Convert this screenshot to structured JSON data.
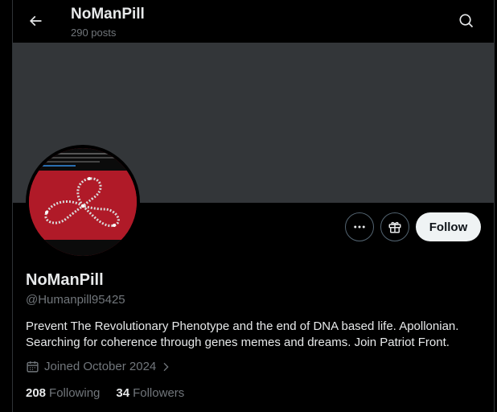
{
  "header": {
    "name": "NoManPill",
    "posts": "290 posts",
    "back_icon": "arrow-left-icon",
    "search_icon": "search-icon"
  },
  "profile": {
    "display_name": "NoManPill",
    "handle": "@Humanpill95425",
    "bio": "Prevent The Revolutionary Phenotype and the end of DNA based life. Apollonian. Searching for coherence through genes memes and dreams. Join Patriot Front.",
    "joined": "Joined October 2024",
    "following_count": "208",
    "following_label": "Following",
    "followers_count": "34",
    "followers_label": "Followers"
  },
  "actions": {
    "more_icon": "more-icon",
    "gift_icon": "gift-icon",
    "follow_label": "Follow"
  },
  "colors": {
    "background": "#000000",
    "banner": "#333639",
    "text_primary": "#e7e9ea",
    "text_secondary": "#71767b",
    "follow_bg": "#eff3f4",
    "avatar_red": "#b01a28"
  }
}
